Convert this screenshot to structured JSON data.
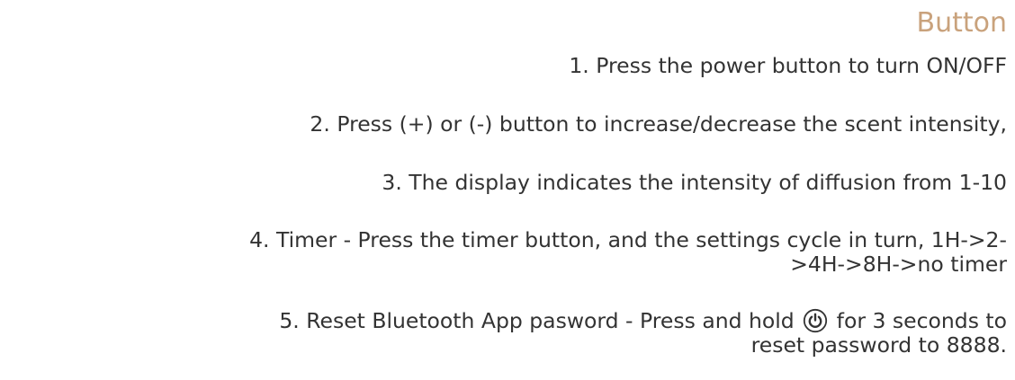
{
  "title": "Button",
  "colors": {
    "title": "#C9A27C",
    "text": "#333333",
    "background": "#FFFFFF"
  },
  "instructions": {
    "step1": "1. Press the power button to turn ON/OFF",
    "step2": "2. Press (+) or (-) button to increase/decrease the scent intensity,",
    "step3": "3. The display indicates the intensity of diffusion from 1-10",
    "step4_line1": "4. Timer - Press the timer button, and the settings cycle in turn, 1H->2-",
    "step4_line2": ">4H->8H->no timer",
    "step5_before_icon": "5. Reset Bluetooth App pasword - Press and hold ",
    "step5_after_icon": " for 3 seconds to",
    "step5_line2": "reset password to 8888.",
    "step5_icon": "power-icon"
  }
}
